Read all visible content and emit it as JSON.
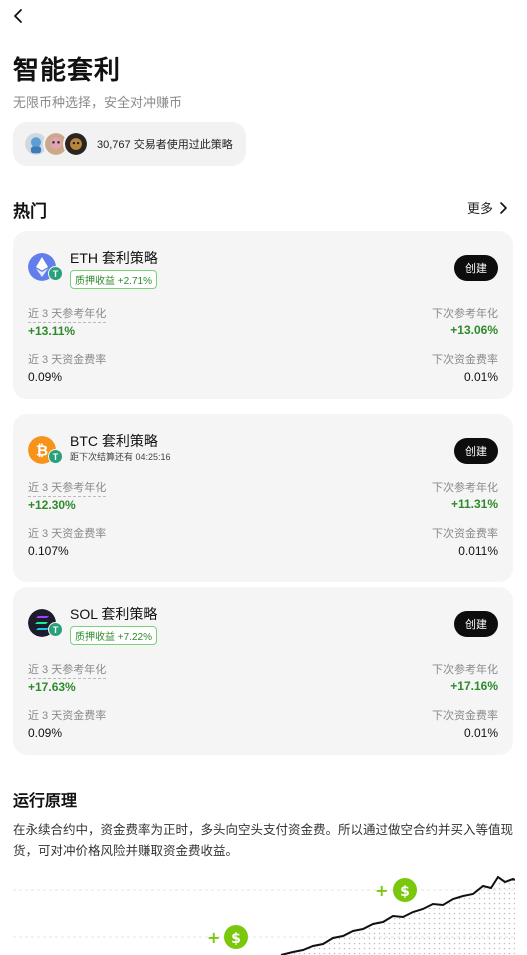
{
  "header": {
    "title": "智能套利",
    "subtitle": "无限币种选择，安全对冲赚币",
    "users_text": "30,767 交易者使用过此策略"
  },
  "hot": {
    "title": "热门",
    "more_label": "更多"
  },
  "cards": [
    {
      "name": "ETH 套利策略",
      "tag": "质押收益 +2.71%",
      "coin_color": "#627eea",
      "create_label": "创建",
      "label_3d_apy": "近 3 天参考年化",
      "value_3d_apy": "+13.11%",
      "label_next_apy": "下次参考年化",
      "value_next_apy": "+13.06%",
      "label_3d_rate": "近 3 天资金费率",
      "value_3d_rate": "0.09%",
      "label_next_rate": "下次资金费率",
      "value_next_rate": "0.01%"
    },
    {
      "name": "BTC 套利策略",
      "countdown": "距下次结算还有 04:25:16",
      "coin_color": "#f7931a",
      "create_label": "创建",
      "label_3d_apy": "近 3 天参考年化",
      "value_3d_apy": "+12.30%",
      "label_next_apy": "下次参考年化",
      "value_next_apy": "+11.31%",
      "label_3d_rate": "近 3 天资金费率",
      "value_3d_rate": "0.107%",
      "label_next_rate": "下次资金费率",
      "value_next_rate": "0.011%"
    },
    {
      "name": "SOL 套利策略",
      "tag": "质押收益 +7.22%",
      "coin_color": "#1c1c2b",
      "create_label": "创建",
      "label_3d_apy": "近 3 天参考年化",
      "value_3d_apy": "+17.63%",
      "label_next_apy": "下次参考年化",
      "value_next_apy": "+17.16%",
      "label_3d_rate": "近 3 天资金费率",
      "value_3d_rate": "0.09%",
      "label_next_rate": "下次资金费率",
      "value_next_rate": "0.01%"
    }
  ],
  "how": {
    "title": "运行原理",
    "description": "在永续合约中，资金费率为正时，多头向空头支付资金费。所以通过做空合约并买入等值现货，可对冲价格风险并赚取资金费收益。"
  },
  "colors": {
    "accent_green": "#2d8a2d",
    "lime": "#7ac70c",
    "button_black": "#0d0d0d"
  },
  "icons": {
    "back": "chevron-left-icon",
    "more": "chevron-right-icon",
    "eth": "eth-coin-icon",
    "btc": "btc-coin-icon",
    "sol": "sol-coin-icon",
    "usdt": "usdt-badge-icon",
    "dollar": "dollar-coin-icon"
  }
}
